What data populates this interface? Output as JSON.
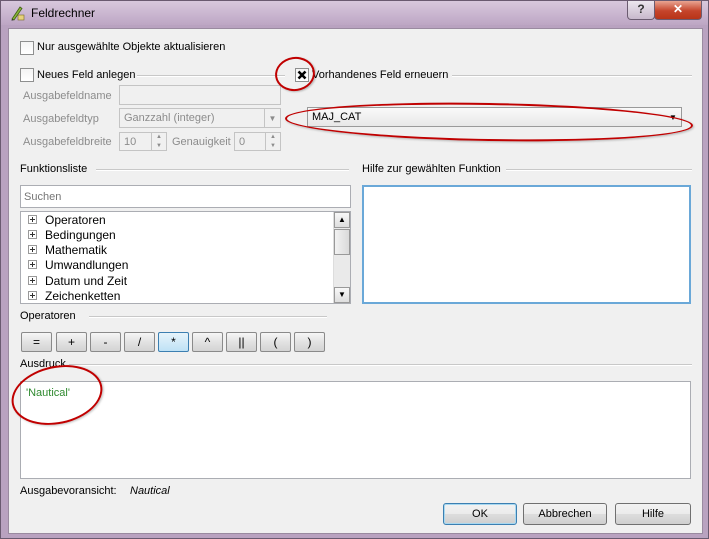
{
  "window": {
    "title": "Feldrechner",
    "help_button": "?",
    "close_button": "✕"
  },
  "options": {
    "only_selected_label": "Nur ausgewählte Objekte aktualisieren",
    "new_field_label": "Neues Feld anlegen",
    "update_field_label": "Vorhandenes Feld erneuern"
  },
  "new_field": {
    "name_label": "Ausgabefeldname",
    "name_value": "",
    "type_label": "Ausgabefeldtyp",
    "type_value": "Ganzzahl (integer)",
    "width_label": "Ausgabefeldbreite",
    "width_value": "10",
    "precision_label": "Genauigkeit",
    "precision_value": "0"
  },
  "existing_field": {
    "selected": "MAJ_CAT"
  },
  "functions": {
    "section_label": "Funktionsliste",
    "search_placeholder": "Suchen",
    "items": [
      "Operatoren",
      "Bedingungen",
      "Mathematik",
      "Umwandlungen",
      "Datum und Zeit",
      "Zeichenketten"
    ]
  },
  "help": {
    "section_label": "Hilfe zur gewählten Funktion",
    "content": ""
  },
  "operators": {
    "section_label": "Operatoren",
    "buttons": [
      "=",
      "+",
      "-",
      "/",
      "*",
      "^",
      "||",
      "(",
      ")"
    ]
  },
  "expression": {
    "section_label": "Ausdruck",
    "value": "'Nautical'"
  },
  "preview": {
    "label": "Ausgabevoransicht:",
    "value": "Nautical"
  },
  "buttons": {
    "ok": "OK",
    "cancel": "Abbrechen",
    "help": "Hilfe"
  },
  "colors": {
    "annotation": "#c00000",
    "expression_text": "#2f8a2f"
  }
}
